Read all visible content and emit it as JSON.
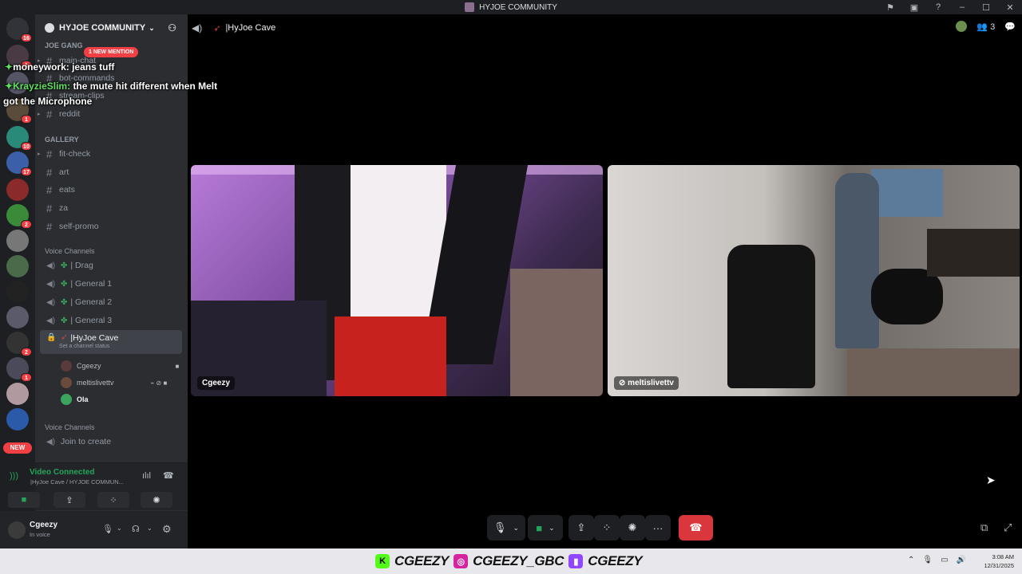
{
  "window": {
    "title": "HYJOE COMMUNITY"
  },
  "server": {
    "name": "HYJOE COMMUNITY"
  },
  "rail_badges": [
    "16",
    "1",
    "1",
    "10",
    "17",
    "2",
    "2",
    "1"
  ],
  "rail_new": "NEW",
  "mention_pill": "1 NEW MENTION",
  "categories": {
    "joe_gang": "JOE GANG",
    "gallery": "GALLERY",
    "voice1": "Voice Channels",
    "voice2": "Voice Channels"
  },
  "channels": {
    "main_chat": "main-chat",
    "bot_commands": "bot-commands",
    "stream_clips": "stream-clips",
    "reddit": "reddit",
    "fit_check": "fit-check",
    "art": "art",
    "eats": "eats",
    "za": "za",
    "self_promo": "self-promo"
  },
  "voice_channels": {
    "drag": "| Drag",
    "general1": "| General 1",
    "general2": "| General 2",
    "general3": "| General 3",
    "cave": "|HyJoe Cave",
    "cave_status": "Set a channel status",
    "join": "Join to create"
  },
  "members": [
    "Cgeezy",
    "meltislivettv",
    "Ola"
  ],
  "voice_panel": {
    "connected": "Video Connected",
    "location": "|HyJoe Cave / HYJOE COMMUN..."
  },
  "user": {
    "name": "Cgeezy",
    "status": "In voice"
  },
  "chat_overlay": [
    {
      "name": "moneywork:",
      "text": "jeans tuff"
    },
    {
      "name": "KrayzieSlim:",
      "text": "the mute hit different when Melt"
    },
    {
      "name": "",
      "text": "got the Microphone"
    }
  ],
  "call": {
    "channel": "|HyJoe Cave",
    "participant_count": "3"
  },
  "tiles": [
    {
      "name": "Cgeezy"
    },
    {
      "name": "meltislivettv"
    }
  ],
  "taskbar": {
    "socials": [
      "CGEEZY",
      "CGEEZY_GBC",
      "CGEEZY"
    ],
    "time": "3:08 AM",
    "date": "12/31/2025"
  },
  "colors": {
    "accent_green": "#23a55a",
    "end_call_red": "#da373c",
    "mention_red": "#f23f43"
  }
}
